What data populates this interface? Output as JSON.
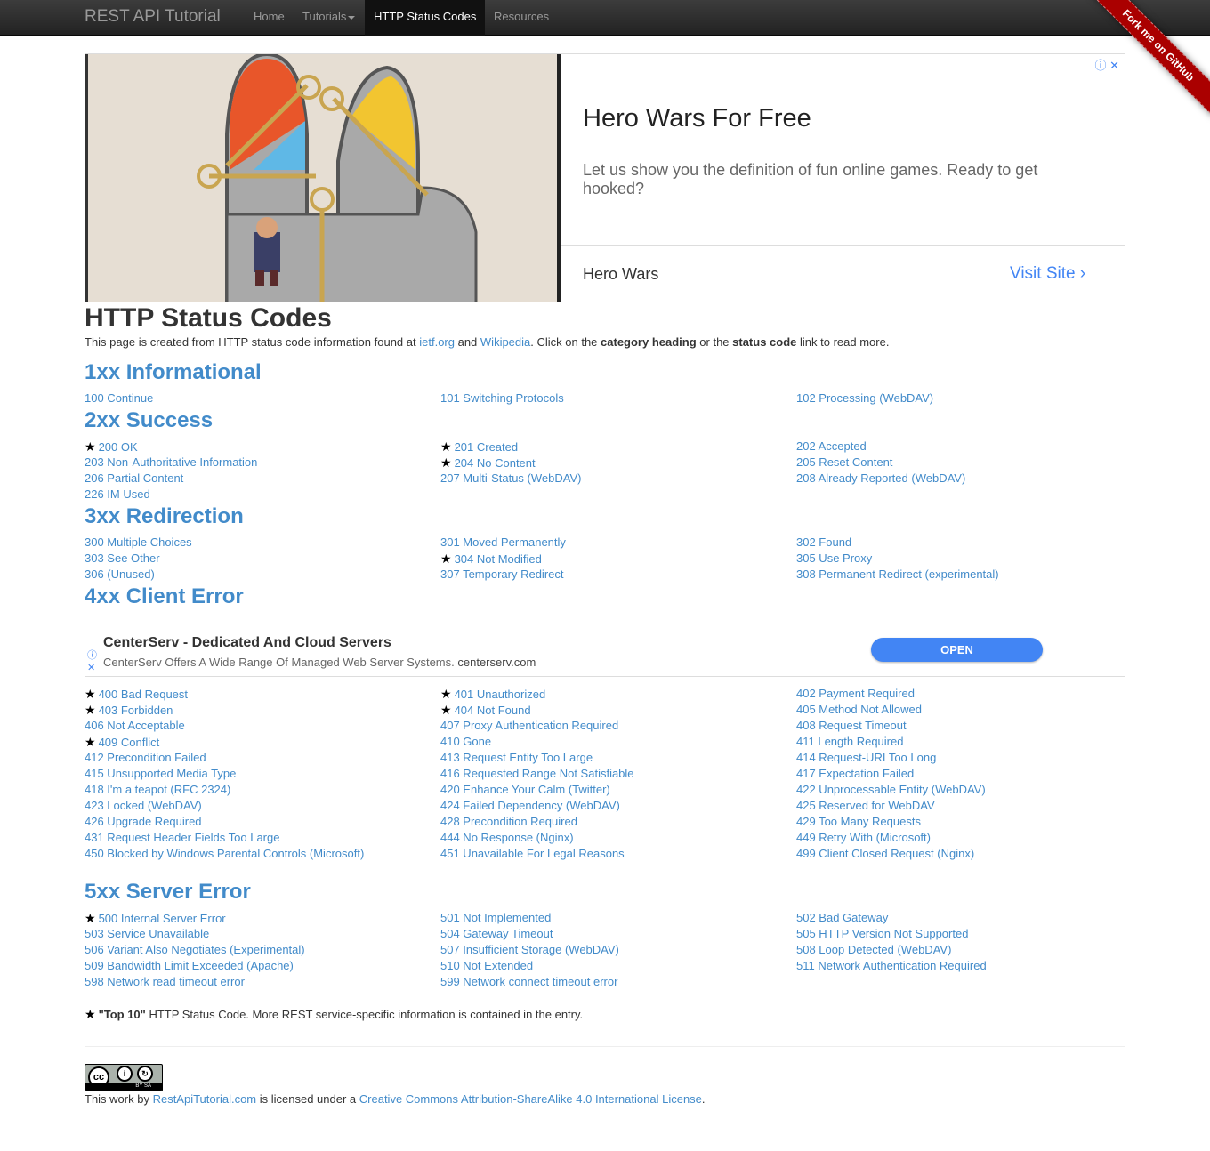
{
  "nav": {
    "brand": "REST API Tutorial",
    "items": [
      "Home",
      "Tutorials",
      "HTTP Status Codes",
      "Resources"
    ],
    "ribbon": "Fork me on GitHub"
  },
  "ad1": {
    "title": "Hero Wars For Free",
    "text": "Let us show you the definition of fun online games. Ready to get hooked?",
    "advertiser": "Hero Wars",
    "cta": "Visit Site ›",
    "close": "ⓘ ✕"
  },
  "page": {
    "title": "HTTP Status Codes",
    "intro_prefix": "This page is created from HTTP status code information found at ",
    "link_ietf": "ietf.org",
    "and": " and ",
    "link_wiki": "Wikipedia",
    "intro_mid": ". Click on the ",
    "category_heading": "category heading",
    "or_the": " or the ",
    "status_code": "status code",
    "intro_suffix": " link to read more."
  },
  "categories": {
    "c1": "1xx Informational",
    "c2": "2xx Success",
    "c3": "3xx Redirection",
    "c4": "4xx Client Error",
    "c5": "5xx Server Error"
  },
  "codes": {
    "r100": [
      "100 Continue",
      "101 Switching Protocols",
      "102 Processing (WebDAV)"
    ],
    "r200": [
      "200 OK",
      "201 Created",
      "202 Accepted"
    ],
    "r203": [
      "203 Non-Authoritative Information",
      "204 No Content",
      "205 Reset Content"
    ],
    "r206": [
      "206 Partial Content",
      "207 Multi-Status (WebDAV)",
      "208 Already Reported (WebDAV)"
    ],
    "r226": [
      "226 IM Used"
    ],
    "r300": [
      "300 Multiple Choices",
      "301 Moved Permanently",
      "302 Found"
    ],
    "r303": [
      "303 See Other",
      "304 Not Modified",
      "305 Use Proxy"
    ],
    "r306": [
      "306 (Unused)",
      "307 Temporary Redirect",
      "308 Permanent Redirect (experimental)"
    ],
    "r400": [
      "400 Bad Request",
      "401 Unauthorized",
      "402 Payment Required"
    ],
    "r403": [
      "403 Forbidden",
      "404 Not Found",
      "405 Method Not Allowed"
    ],
    "r406": [
      "406 Not Acceptable",
      "407 Proxy Authentication Required",
      "408 Request Timeout"
    ],
    "r409": [
      "409 Conflict",
      "410 Gone",
      "411 Length Required"
    ],
    "r412": [
      "412 Precondition Failed",
      "413 Request Entity Too Large",
      "414 Request-URI Too Long"
    ],
    "r415": [
      "415 Unsupported Media Type",
      "416 Requested Range Not Satisfiable",
      "417 Expectation Failed"
    ],
    "r418": [
      "418 I'm a teapot (RFC 2324)",
      "420 Enhance Your Calm (Twitter)",
      "422 Unprocessable Entity (WebDAV)"
    ],
    "r423": [
      "423 Locked (WebDAV)",
      "424 Failed Dependency (WebDAV)",
      "425 Reserved for WebDAV"
    ],
    "r426": [
      "426 Upgrade Required",
      "428 Precondition Required",
      "429 Too Many Requests"
    ],
    "r431": [
      "431 Request Header Fields Too Large",
      "444 No Response (Nginx)",
      "449 Retry With (Microsoft)"
    ],
    "r450": [
      "450 Blocked by Windows Parental Controls (Microsoft)",
      "451 Unavailable For Legal Reasons",
      "499 Client Closed Request (Nginx)"
    ],
    "r500": [
      "500 Internal Server Error",
      "501 Not Implemented",
      "502 Bad Gateway"
    ],
    "r503": [
      "503 Service Unavailable",
      "504 Gateway Timeout",
      "505 HTTP Version Not Supported"
    ],
    "r506": [
      "506 Variant Also Negotiates (Experimental)",
      "507 Insufficient Storage (WebDAV)",
      "508 Loop Detected (WebDAV)"
    ],
    "r509": [
      "509 Bandwidth Limit Exceeded (Apache)",
      "510 Not Extended",
      "511 Network Authentication Required"
    ],
    "r598": [
      "598 Network read timeout error",
      "599 Network connect timeout error"
    ]
  },
  "star": "★",
  "ad2": {
    "title": "CenterServ - Dedicated And Cloud Servers",
    "text": "CenterServ Offers A Wide Range Of Managed Web Server Systems.",
    "domain": "centerserv.com",
    "cta": "OPEN",
    "info": "ⓘ",
    "close": "✕"
  },
  "footnote": {
    "top10": "\"Top 10\"",
    "text": " HTTP Status Code. More REST service-specific information is contained in the entry."
  },
  "license": {
    "prefix": "This work by ",
    "site": "RestApiTutorial.com",
    "mid": " is licensed under a ",
    "link": "Creative Commons Attribution-ShareAlike 4.0 International License",
    "suffix": ".",
    "badge": "BY  SA"
  },
  "colors": {
    "link": "#428bca",
    "navbar": "#222222",
    "ribbon": "#aa0000",
    "ad_button": "#4285f4"
  }
}
